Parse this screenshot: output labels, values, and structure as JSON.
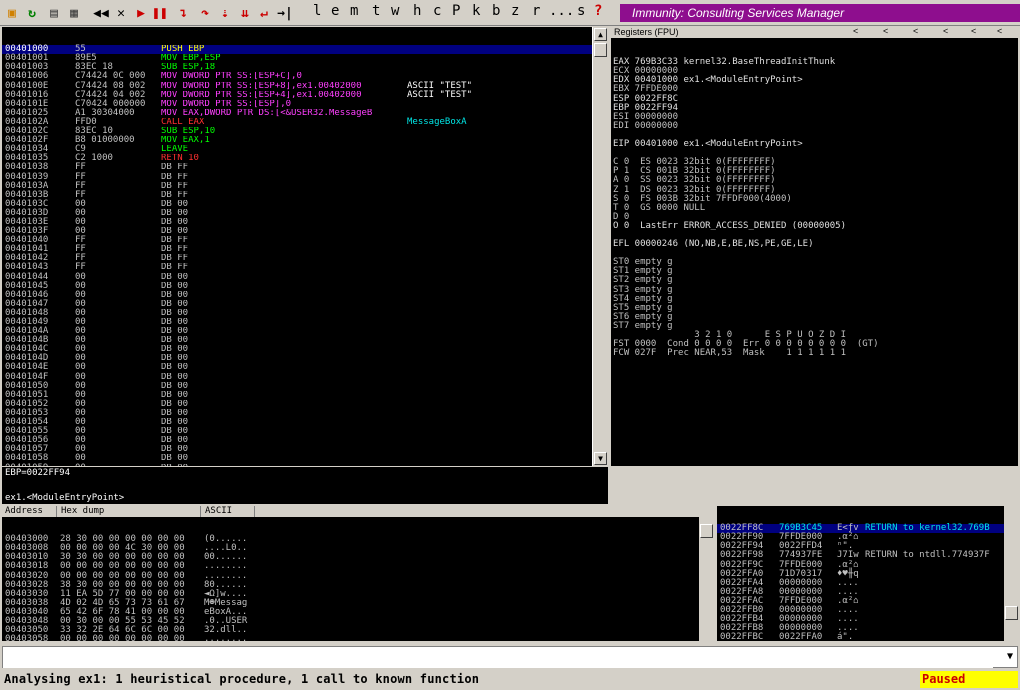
{
  "toolbar": {
    "letters": [
      "l",
      "e",
      "m",
      "t",
      "w",
      "h",
      "c",
      "P",
      "k",
      "b",
      "z",
      "r",
      "...",
      "s",
      "?"
    ],
    "title": "Immunity: Consulting Services Manager"
  },
  "cpu": {
    "rows": [
      {
        "addr": "00401000",
        "hex": "55",
        "asm": "PUSH EBP",
        "cmt": ""
      },
      {
        "addr": "00401001",
        "hex": "89E5",
        "asm": "MOV EBP,ESP",
        "cmt": ""
      },
      {
        "addr": "00401003",
        "hex": "83EC 18",
        "asm": "SUB ESP,18",
        "cmt": ""
      },
      {
        "addr": "00401006",
        "hex": "C74424 0C 000",
        "asm": "MOV DWORD PTR SS:[ESP+C],0",
        "cmt": ""
      },
      {
        "addr": "0040100E",
        "hex": "C74424 08 002",
        "asm": "MOV DWORD PTR SS:[ESP+8],ex1.00402000",
        "cmt": "ASCII \"TEST\""
      },
      {
        "addr": "00401016",
        "hex": "C74424 04 002",
        "asm": "MOV DWORD PTR SS:[ESP+4],ex1.00402000",
        "cmt": "ASCII \"TEST\""
      },
      {
        "addr": "0040101E",
        "hex": "C70424 000000",
        "asm": "MOV DWORD PTR SS:[ESP],0",
        "cmt": ""
      },
      {
        "addr": "00401025",
        "hex": "A1 30304000",
        "asm": "MOV EAX,DWORD PTR DS:[<&USER32.MessageB",
        "cmt": ""
      },
      {
        "addr": "0040102A",
        "hex": "FFD0",
        "asm": "CALL EAX",
        "cmt": "MessageBoxA"
      },
      {
        "addr": "0040102C",
        "hex": "83EC 10",
        "asm": "SUB ESP,10",
        "cmt": ""
      },
      {
        "addr": "0040102F",
        "hex": "B8 01000000",
        "asm": "MOV EAX,1",
        "cmt": ""
      },
      {
        "addr": "00401034",
        "hex": "C9",
        "asm": "LEAVE",
        "cmt": ""
      },
      {
        "addr": "00401035",
        "hex": "C2 1000",
        "asm": "RETN 10",
        "cmt": ""
      },
      {
        "addr": "00401038",
        "hex": "FF",
        "asm": "DB FF",
        "cmt": ""
      },
      {
        "addr": "00401039",
        "hex": "FF",
        "asm": "DB FF",
        "cmt": ""
      },
      {
        "addr": "0040103A",
        "hex": "FF",
        "asm": "DB FF",
        "cmt": ""
      },
      {
        "addr": "0040103B",
        "hex": "FF",
        "asm": "DB FF",
        "cmt": ""
      },
      {
        "addr": "0040103C",
        "hex": "00",
        "asm": "DB 00",
        "cmt": ""
      },
      {
        "addr": "0040103D",
        "hex": "00",
        "asm": "DB 00",
        "cmt": ""
      },
      {
        "addr": "0040103E",
        "hex": "00",
        "asm": "DB 00",
        "cmt": ""
      },
      {
        "addr": "0040103F",
        "hex": "00",
        "asm": "DB 00",
        "cmt": ""
      },
      {
        "addr": "00401040",
        "hex": "FF",
        "asm": "DB FF",
        "cmt": ""
      },
      {
        "addr": "00401041",
        "hex": "FF",
        "asm": "DB FF",
        "cmt": ""
      },
      {
        "addr": "00401042",
        "hex": "FF",
        "asm": "DB FF",
        "cmt": ""
      },
      {
        "addr": "00401043",
        "hex": "FF",
        "asm": "DB FF",
        "cmt": ""
      },
      {
        "addr": "00401044",
        "hex": "00",
        "asm": "DB 00",
        "cmt": ""
      },
      {
        "addr": "00401045",
        "hex": "00",
        "asm": "DB 00",
        "cmt": ""
      },
      {
        "addr": "00401046",
        "hex": "00",
        "asm": "DB 00",
        "cmt": ""
      },
      {
        "addr": "00401047",
        "hex": "00",
        "asm": "DB 00",
        "cmt": ""
      },
      {
        "addr": "00401048",
        "hex": "00",
        "asm": "DB 00",
        "cmt": ""
      },
      {
        "addr": "00401049",
        "hex": "00",
        "asm": "DB 00",
        "cmt": ""
      },
      {
        "addr": "0040104A",
        "hex": "00",
        "asm": "DB 00",
        "cmt": ""
      },
      {
        "addr": "0040104B",
        "hex": "00",
        "asm": "DB 00",
        "cmt": ""
      },
      {
        "addr": "0040104C",
        "hex": "00",
        "asm": "DB 00",
        "cmt": ""
      },
      {
        "addr": "0040104D",
        "hex": "00",
        "asm": "DB 00",
        "cmt": ""
      },
      {
        "addr": "0040104E",
        "hex": "00",
        "asm": "DB 00",
        "cmt": ""
      },
      {
        "addr": "0040104F",
        "hex": "00",
        "asm": "DB 00",
        "cmt": ""
      },
      {
        "addr": "00401050",
        "hex": "00",
        "asm": "DB 00",
        "cmt": ""
      },
      {
        "addr": "00401051",
        "hex": "00",
        "asm": "DB 00",
        "cmt": ""
      },
      {
        "addr": "00401052",
        "hex": "00",
        "asm": "DB 00",
        "cmt": ""
      },
      {
        "addr": "00401053",
        "hex": "00",
        "asm": "DB 00",
        "cmt": ""
      },
      {
        "addr": "00401054",
        "hex": "00",
        "asm": "DB 00",
        "cmt": ""
      },
      {
        "addr": "00401055",
        "hex": "00",
        "asm": "DB 00",
        "cmt": ""
      },
      {
        "addr": "00401056",
        "hex": "00",
        "asm": "DB 00",
        "cmt": ""
      },
      {
        "addr": "00401057",
        "hex": "00",
        "asm": "DB 00",
        "cmt": ""
      },
      {
        "addr": "00401058",
        "hex": "00",
        "asm": "DB 00",
        "cmt": ""
      },
      {
        "addr": "00401059",
        "hex": "00",
        "asm": "DB 00",
        "cmt": ""
      },
      {
        "addr": "0040105A",
        "hex": "00",
        "asm": "DB 00",
        "cmt": ""
      },
      {
        "addr": "0040105B",
        "hex": "00",
        "asm": "DB 00",
        "cmt": ""
      }
    ]
  },
  "info": {
    "line1": "EBP=0022FF94",
    "line2": "ex1.<ModuleEntryPoint>"
  },
  "registers": {
    "header": "Registers (FPU)",
    "arrows": [
      "<",
      "<",
      "<",
      "<",
      "<",
      "<",
      "<",
      "<"
    ],
    "lines": [
      {
        "t": "EAX 769B3C33 kernel32.BaseThreadInitThunk"
      },
      {
        "t": "ECX 00000000"
      },
      {
        "t": "EDX 00401000 ex1.<ModuleEntryPoint>"
      },
      {
        "t": "EBX 7FFDE000"
      },
      {
        "t": "ESP 0022FF8C"
      },
      {
        "t": "EBP 0022FF94"
      },
      {
        "t": "ESI 00000000"
      },
      {
        "t": "EDI 00000000"
      },
      {
        "t": ""
      },
      {
        "t": "EIP 00401000 ex1.<ModuleEntryPoint>"
      },
      {
        "t": ""
      },
      {
        "t": "C 0  ES 0023 32bit 0(FFFFFFFF)"
      },
      {
        "t": "P 1  CS 001B 32bit 0(FFFFFFFF)"
      },
      {
        "t": "A 0  SS 0023 32bit 0(FFFFFFFF)"
      },
      {
        "t": "Z 1  DS 0023 32bit 0(FFFFFFFF)"
      },
      {
        "t": "S 0  FS 003B 32bit 7FFDF000(4000)"
      },
      {
        "t": "T 0  GS 0000 NULL"
      },
      {
        "t": "D 0"
      },
      {
        "t": "O 0  LastErr ERROR_ACCESS_DENIED (00000005)"
      },
      {
        "t": ""
      },
      {
        "t": "EFL 00000246 (NO,NB,E,BE,NS,PE,GE,LE)"
      },
      {
        "t": ""
      },
      {
        "t": "ST0 empty g"
      },
      {
        "t": "ST1 empty g"
      },
      {
        "t": "ST2 empty g"
      },
      {
        "t": "ST3 empty g"
      },
      {
        "t": "ST4 empty g"
      },
      {
        "t": "ST5 empty g"
      },
      {
        "t": "ST6 empty g"
      },
      {
        "t": "ST7 empty g"
      },
      {
        "t": "               3 2 1 0      E S P U O Z D I"
      },
      {
        "t": "FST 0000  Cond 0 0 0 0  Err 0 0 0 0 0 0 0 0  (GT)"
      },
      {
        "t": "FCW 027F  Prec NEAR,53  Mask    1 1 1 1 1 1"
      }
    ]
  },
  "dump": {
    "headers": [
      "Address",
      "Hex dump",
      "ASCII"
    ],
    "rows": [
      {
        "addr": "00403000",
        "hex": "28 30 00 00 00 00 00 00",
        "ascii": "(0......"
      },
      {
        "addr": "00403008",
        "hex": "00 00 00 00 4C 30 00 00",
        "ascii": "....L0.."
      },
      {
        "addr": "00403010",
        "hex": "30 30 00 00 00 00 00 00",
        "ascii": "00......"
      },
      {
        "addr": "00403018",
        "hex": "00 00 00 00 00 00 00 00",
        "ascii": "........"
      },
      {
        "addr": "00403020",
        "hex": "00 00 00 00 00 00 00 00",
        "ascii": "........"
      },
      {
        "addr": "00403028",
        "hex": "38 30 00 00 00 00 00 00",
        "ascii": "80......"
      },
      {
        "addr": "00403030",
        "hex": "11 EA 5D 77 00 00 00 00",
        "ascii": "◄Ω]w...."
      },
      {
        "addr": "00403038",
        "hex": "4D 02 4D 65 73 73 61 67",
        "ascii": "M☻Messag"
      },
      {
        "addr": "00403040",
        "hex": "65 42 6F 78 41 00 00 00",
        "ascii": "eBoxA..."
      },
      {
        "addr": "00403048",
        "hex": "00 30 00 00 55 53 45 52",
        "ascii": ".0..USER"
      },
      {
        "addr": "00403050",
        "hex": "33 32 2E 64 6C 6C 00 00",
        "ascii": "32.dll.."
      },
      {
        "addr": "00403058",
        "hex": "00 00 00 00 00 00 00 00",
        "ascii": "........"
      },
      {
        "addr": "00403060",
        "hex": "00 00 00 00 00 00 00 00",
        "ascii": "........"
      }
    ]
  },
  "stack": {
    "rows": [
      {
        "addr": "0022FF8C",
        "val": "769B3C45",
        "asc": "E<ƒv",
        "cmt": "RETURN to kernel32.769B"
      },
      {
        "addr": "0022FF90",
        "val": "7FFDE000",
        "asc": ".α²⌂",
        "cmt": ""
      },
      {
        "addr": "0022FF94",
        "val": "0022FFD4",
        "asc": "ⁿ\".",
        "cmt": ""
      },
      {
        "addr": "0022FF98",
        "val": "774937FE",
        "asc": "J7Iw",
        "cmt": "RETURN to ntdll.774937F"
      },
      {
        "addr": "0022FF9C",
        "val": "7FFDE000",
        "asc": ".α²⌂",
        "cmt": ""
      },
      {
        "addr": "0022FFA0",
        "val": "71D70317",
        "asc": "♦♥╫q",
        "cmt": ""
      },
      {
        "addr": "0022FFA4",
        "val": "00000000",
        "asc": "....",
        "cmt": ""
      },
      {
        "addr": "0022FFA8",
        "val": "00000000",
        "asc": "....",
        "cmt": ""
      },
      {
        "addr": "0022FFAC",
        "val": "7FFDE000",
        "asc": ".α²⌂",
        "cmt": ""
      },
      {
        "addr": "0022FFB0",
        "val": "00000000",
        "asc": "....",
        "cmt": ""
      },
      {
        "addr": "0022FFB4",
        "val": "00000000",
        "asc": "....",
        "cmt": ""
      },
      {
        "addr": "0022FFB8",
        "val": "00000000",
        "asc": "....",
        "cmt": ""
      },
      {
        "addr": "0022FFBC",
        "val": "0022FFA0",
        "asc": "á\".",
        "cmt": ""
      },
      {
        "addr": "0022FFC0",
        "val": "00000000",
        "asc": "....",
        "cmt": ""
      },
      {
        "addr": "0022FFC4",
        "val": "FFFFFFFF",
        "asc": "",
        "cmt": "End of SEH chain"
      }
    ]
  },
  "command": {
    "value": ""
  },
  "status": {
    "text": "Analysing ex1: 1 heuristical procedure, 1 call to known function",
    "state": "Paused"
  },
  "colors": {
    "titlebar": "#8E0E8E",
    "selection": "#000080",
    "paused_bg": "#FFFF00"
  }
}
